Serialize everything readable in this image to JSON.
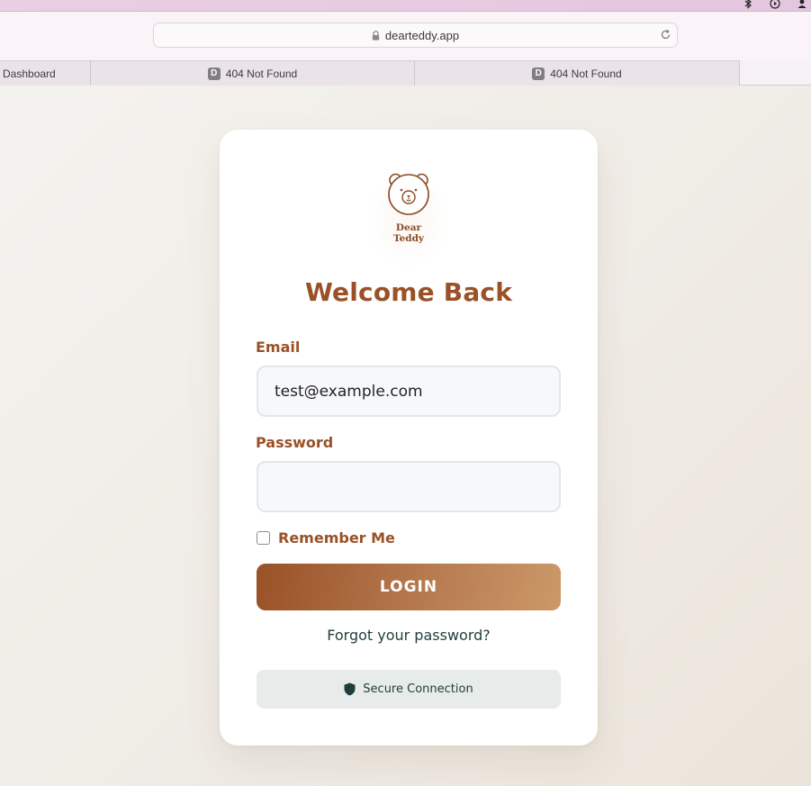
{
  "browser": {
    "url": "dearteddy.app",
    "tabs": [
      {
        "label": "Dashboard",
        "favicon": ""
      },
      {
        "label": "404 Not Found",
        "favicon": "D"
      },
      {
        "label": "404 Not Found",
        "favicon": "D"
      }
    ],
    "menubar_icons": [
      "bluetooth-icon",
      "play-circle-icon",
      "user-icon"
    ]
  },
  "login": {
    "logo_line1": "Dear",
    "logo_line2": "Teddy",
    "title": "Welcome Back",
    "email_label": "Email",
    "email_value": "test@example.com",
    "password_label": "Password",
    "password_value": "",
    "remember_label": "Remember Me",
    "remember_checked": false,
    "login_button": "LOGIN",
    "forgot_link": "Forgot your password?",
    "secure_text": "Secure Connection"
  },
  "colors": {
    "brand_brown": "#9a5127",
    "button_gradient_end": "#cc9868",
    "dark_teal": "#1f3d3b"
  }
}
